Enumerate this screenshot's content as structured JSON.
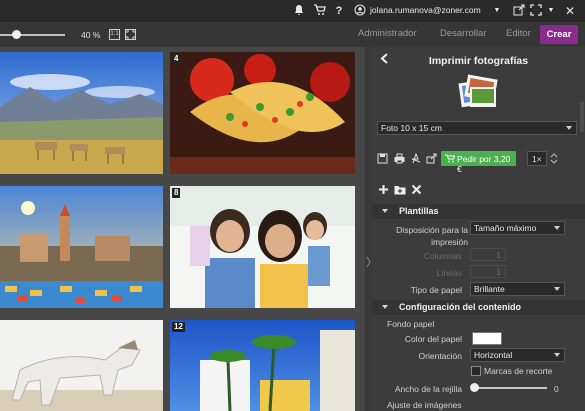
{
  "topbar": {
    "email": "jolana.rumanova@zoner.com",
    "icons": [
      "bell-icon",
      "cart-icon",
      "help-icon",
      "user-icon",
      "chevron-down-icon",
      "export-icon",
      "fullscreen-icon"
    ]
  },
  "toolbar": {
    "zoom": "40 %",
    "zoom_level": 0.25,
    "modes": [
      "Administrador",
      "Desarrollar",
      "Editor"
    ],
    "create": "Crear",
    "accent": "#8a2c8e"
  },
  "grid": {
    "numbers": [
      "4",
      "8",
      "12"
    ]
  },
  "panel": {
    "title": "Imprimir fotografías",
    "size_select": "Foto 10 x 15 cm",
    "order_button": "Pedir por 3,20 €",
    "order_color": "#4caf50",
    "copies": "1×",
    "sec_templates": "Plantillas",
    "layout_label": "Disposición para la impresión",
    "layout_value": "Tamaño máximo",
    "columns_label": "Columnas",
    "columns_value": "1",
    "rows_label": "Líneas",
    "rows_value": "1",
    "paper_type_label": "Tipo de papel",
    "paper_type_value": "Brillante",
    "sec_content": "Configuración del contenido",
    "paper_bg_label": "Fondo papel",
    "paper_color_label": "Color del papel",
    "paper_color": "#ffffff",
    "orientation_label": "Orientación",
    "orientation_value": "Horizontal",
    "crop_marks_label": "Marcas de recorte",
    "grid_width_label": "Ancho de la rejilla",
    "grid_width_value": "0",
    "image_fit_label": "Ajuste de imágenes"
  }
}
